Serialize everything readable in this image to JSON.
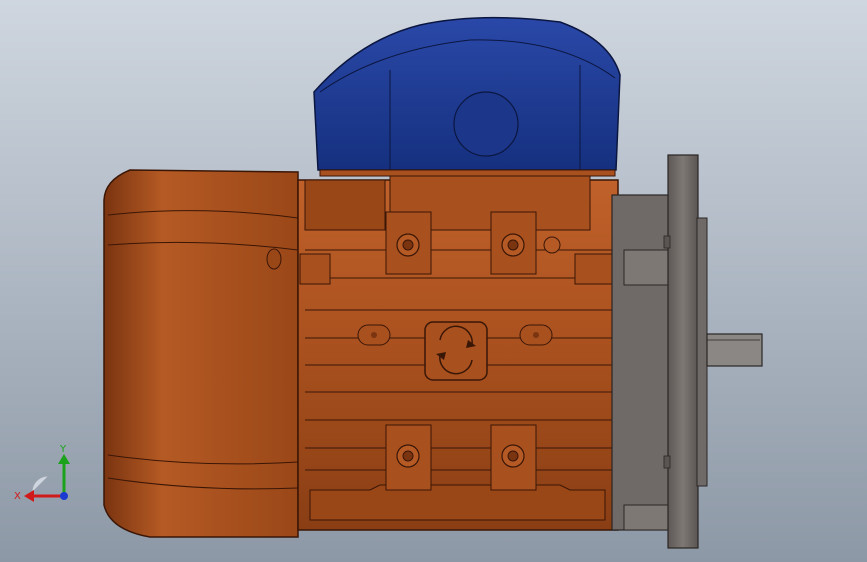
{
  "scene": {
    "background_top": "#cfd6df",
    "background_bottom": "#8d98a6",
    "colors": {
      "motor_body": "#a8501e",
      "motor_shadow": "#7a3410",
      "motor_edge": "#3a1606",
      "gearbox_cover": "#1f3a8f",
      "gearbox_edge": "#0b1640",
      "flange": "#6f6a67",
      "shaft": "#8a8785"
    }
  },
  "triad": {
    "x_label": "X",
    "y_label": "Y",
    "x_color": "#d11a1a",
    "y_color": "#1aa31a",
    "z_color": "#1a3ad1"
  }
}
